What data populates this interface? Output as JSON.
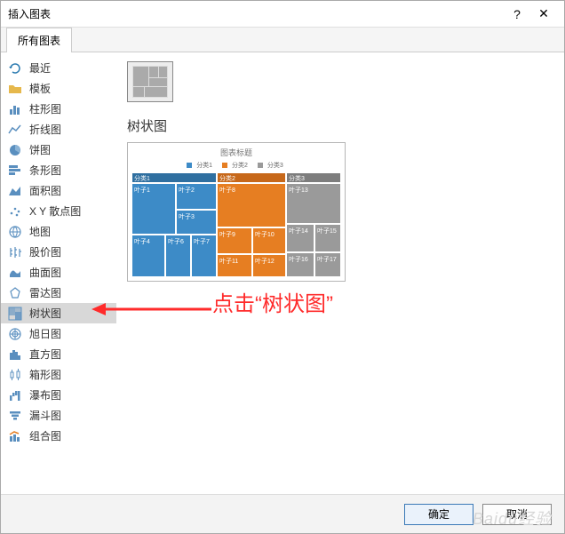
{
  "titlebar": {
    "title": "插入图表",
    "help": "?",
    "close": "✕"
  },
  "tabs": {
    "active": "所有图表"
  },
  "sidebar": {
    "items": [
      {
        "label": "最近"
      },
      {
        "label": "模板"
      },
      {
        "label": "柱形图"
      },
      {
        "label": "折线图"
      },
      {
        "label": "饼图"
      },
      {
        "label": "条形图"
      },
      {
        "label": "面积图"
      },
      {
        "label": "X Y 散点图"
      },
      {
        "label": "地图"
      },
      {
        "label": "股价图"
      },
      {
        "label": "曲面图"
      },
      {
        "label": "雷达图"
      },
      {
        "label": "树状图"
      },
      {
        "label": "旭日图"
      },
      {
        "label": "直方图"
      },
      {
        "label": "箱形图"
      },
      {
        "label": "瀑布图"
      },
      {
        "label": "漏斗图"
      },
      {
        "label": "组合图"
      }
    ]
  },
  "content": {
    "heading": "树状图",
    "preview_title": "图表标题",
    "legend": [
      "分类1",
      "分类2",
      "分类3"
    ]
  },
  "chart_data": {
    "type": "treemap",
    "title": "图表标题",
    "categories": [
      {
        "name": "分类1",
        "color": "#3d8bc7",
        "children": [
          {
            "name": "叶子1",
            "value": 28
          },
          {
            "name": "叶子2",
            "value": 18
          },
          {
            "name": "叶子3",
            "value": 14
          },
          {
            "name": "叶子4",
            "value": 8
          },
          {
            "name": "叶子6",
            "value": 6
          },
          {
            "name": "叶子7",
            "value": 6
          }
        ]
      },
      {
        "name": "分类2",
        "color": "#e67e22",
        "children": [
          {
            "name": "叶子8",
            "value": 22
          },
          {
            "name": "叶子9",
            "value": 12
          },
          {
            "name": "叶子10",
            "value": 8
          },
          {
            "name": "叶子11",
            "value": 8
          },
          {
            "name": "叶子12",
            "value": 6
          }
        ]
      },
      {
        "name": "分类3",
        "color": "#9a9a9a",
        "children": [
          {
            "name": "叶子13",
            "value": 20
          },
          {
            "name": "叶子14",
            "value": 10
          },
          {
            "name": "叶子15",
            "value": 10
          },
          {
            "name": "叶子16",
            "value": 4
          },
          {
            "name": "叶子17",
            "value": 4
          }
        ]
      }
    ]
  },
  "annotation": {
    "text": "点击“树状图”"
  },
  "footer": {
    "ok": "确定",
    "cancel": "取消"
  },
  "watermark": "Baidu经验"
}
